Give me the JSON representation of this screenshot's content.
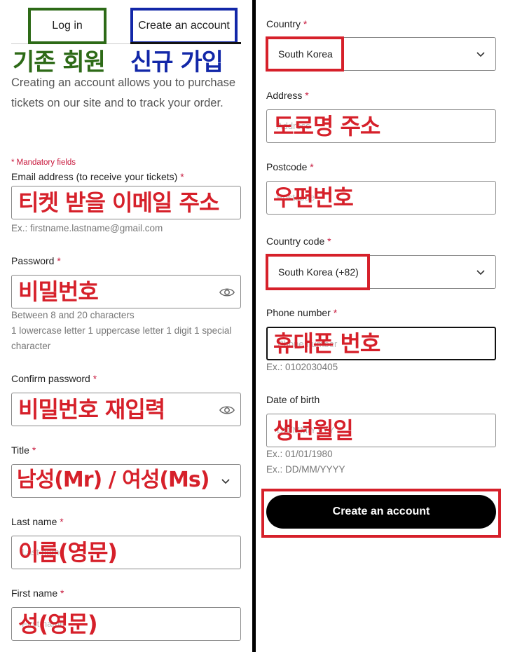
{
  "tabs": {
    "login_label": "Log in",
    "create_label": "Create an account",
    "login_annotation": "기존 회원",
    "create_annotation": "신규 가입"
  },
  "intro": "Creating an account allows you to purchase tickets on our site and to track your order.",
  "mandatory_note": "* Mandatory fields",
  "required_mark": "*",
  "colors": {
    "annotation_red": "#d6202a",
    "annotation_green": "#2d6a17",
    "annotation_blue": "#1227a8",
    "required": "#c8183c"
  },
  "fields": {
    "email": {
      "label": "Email address (to receive your tickets)",
      "annotation": "티켓 받을 이메일 주소",
      "hint": "Ex.: firstname.lastname@gmail.com"
    },
    "password": {
      "label": "Password",
      "annotation": "비밀번호",
      "hint1": "Between 8 and 20 characters",
      "hint2": "1 lowercase letter 1 uppercase letter 1 digit 1 special character",
      "icon": "eye-icon"
    },
    "confirm_password": {
      "label": "Confirm password",
      "annotation": "비밀번호 재입력",
      "icon": "eye-icon"
    },
    "title": {
      "label": "Title",
      "annotation": "남성(Mr) / 여성(Ms)"
    },
    "last_name": {
      "label": "Last name",
      "annotation": "이름(영문)",
      "placeholder": "Last name"
    },
    "first_name": {
      "label": "First name",
      "annotation": "성(영문)",
      "placeholder": "First name"
    },
    "country": {
      "label": "Country",
      "value": "South Korea",
      "icon": "chevron-down-icon"
    },
    "address": {
      "label": "Address",
      "annotation": "도로명 주소",
      "placeholder": "Address"
    },
    "postcode": {
      "label": "Postcode",
      "annotation": "우편번호",
      "placeholder": "Postcode"
    },
    "country_code": {
      "label": "Country code",
      "value": "South Korea (+82)",
      "icon": "chevron-down-icon"
    },
    "phone": {
      "label": "Phone number",
      "annotation": "휴대폰 번호",
      "placeholder": "Phone number",
      "hint": "Ex.: 0102030405"
    },
    "dob": {
      "label": "Date of birth",
      "annotation": "생년월일",
      "placeholder": "DD/MM/YYYY",
      "hint1": "Ex.: 01/01/1980",
      "hint2": "Ex.: DD/MM/YYYY"
    }
  },
  "submit_label": "Create an account"
}
